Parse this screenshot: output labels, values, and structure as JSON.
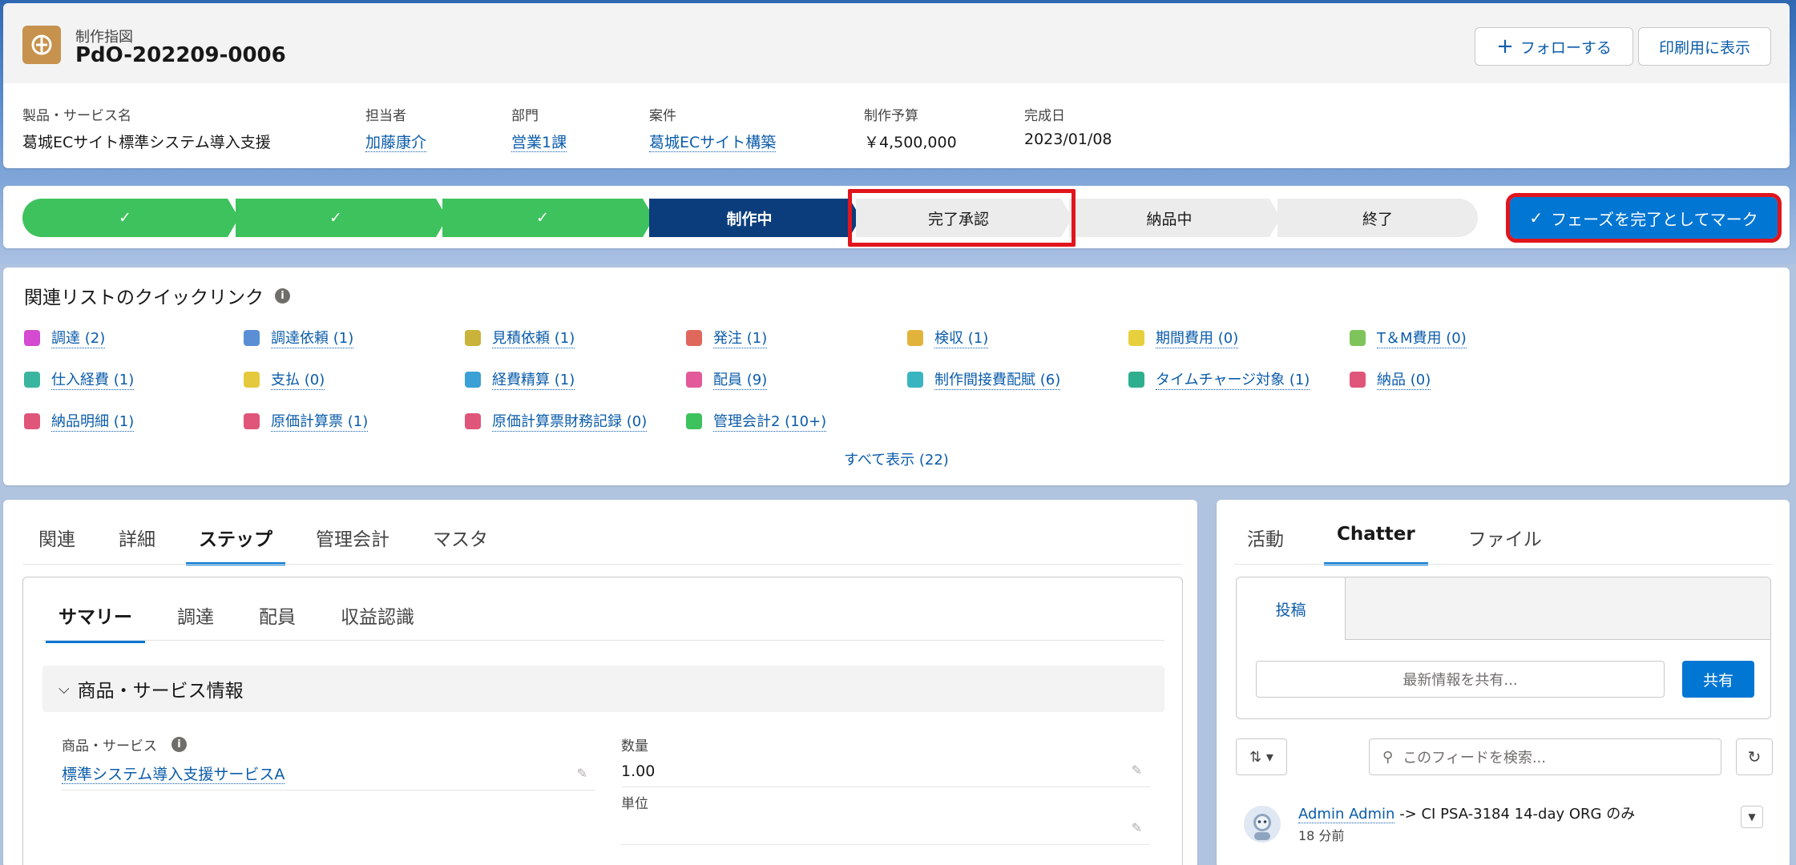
{
  "record": {
    "object_label": "制作指図",
    "title": "PdO-202209-0006",
    "follow_label": "フォローする",
    "print_label": "印刷用に表示"
  },
  "highlights": [
    {
      "label": "製品・サービス名",
      "value": "葛城ECサイト標準システム導入支援",
      "link": false
    },
    {
      "label": "担当者",
      "value": "加藤康介",
      "link": true
    },
    {
      "label": "部門",
      "value": "営業1課",
      "link": true
    },
    {
      "label": "案件",
      "value": "葛城ECサイト構築",
      "link": true
    },
    {
      "label": "制作予算",
      "value": "￥4,500,000",
      "link": false
    },
    {
      "label": "完成日",
      "value": "2023/01/08",
      "link": false
    }
  ],
  "path": {
    "steps": [
      {
        "label": "✓",
        "state": "done"
      },
      {
        "label": "✓",
        "state": "done"
      },
      {
        "label": "✓",
        "state": "done"
      },
      {
        "label": "制作中",
        "state": "current"
      },
      {
        "label": "完了承認",
        "state": "todo"
      },
      {
        "label": "納品中",
        "state": "todo"
      },
      {
        "label": "終了",
        "state": "todo"
      }
    ],
    "mark_button": "フェーズを完了としてマーク"
  },
  "quick_links": {
    "title": "関連リストのクイックリンク",
    "show_all": "すべて表示 (22)",
    "items": [
      {
        "label": "調達 (2)",
        "color": "#d44ad1"
      },
      {
        "label": "調達依頼 (1)",
        "color": "#5a8fd6"
      },
      {
        "label": "見積依頼 (1)",
        "color": "#c9b33a"
      },
      {
        "label": "発注 (1)",
        "color": "#e0675c"
      },
      {
        "label": "検収 (1)",
        "color": "#e2b33a"
      },
      {
        "label": "期間費用 (0)",
        "color": "#e8cf3d"
      },
      {
        "label": "T＆M費用 (0)",
        "color": "#7fc45a"
      },
      {
        "label": "仕入経費 (1)",
        "color": "#3ab5a0"
      },
      {
        "label": "支払 (0)",
        "color": "#e4c93c"
      },
      {
        "label": "経費精算 (1)",
        "color": "#3aa0d5"
      },
      {
        "label": "配員 (9)",
        "color": "#e35a9a"
      },
      {
        "label": "制作間接費配賦 (6)",
        "color": "#3ab5c0"
      },
      {
        "label": "タイムチャージ対象 (1)",
        "color": "#2fae8f"
      },
      {
        "label": "納品 (0)",
        "color": "#e0557a"
      },
      {
        "label": "納品明細 (1)",
        "color": "#e0557a"
      },
      {
        "label": "原価計算票 (1)",
        "color": "#e0557a"
      },
      {
        "label": "原価計算票財務記録 (0)",
        "color": "#e0557a"
      },
      {
        "label": "管理会計2 (10+)",
        "color": "#3ec25d"
      }
    ]
  },
  "main_tabs": [
    "関連",
    "詳細",
    "ステップ",
    "管理会計",
    "マスタ"
  ],
  "sub_tabs": [
    "サマリー",
    "調達",
    "配員",
    "収益認識"
  ],
  "section": {
    "title": "商品・サービス情報",
    "product_label": "商品・サービス",
    "product_value": "標準システム導入支援サービスA",
    "qty_label": "数量",
    "qty_value": "1.00",
    "unit_label": "単位",
    "unit_value": ""
  },
  "side_tabs": [
    "活動",
    "Chatter",
    "ファイル"
  ],
  "chatter": {
    "post_tab": "投稿",
    "share_placeholder": "最新情報を共有...",
    "share_button": "共有",
    "search_placeholder": "このフィードを検索...",
    "feed_user": "Admin Admin",
    "feed_target": " -> CI PSA-3184 14-day ORG のみ",
    "feed_time": "18 分前"
  }
}
